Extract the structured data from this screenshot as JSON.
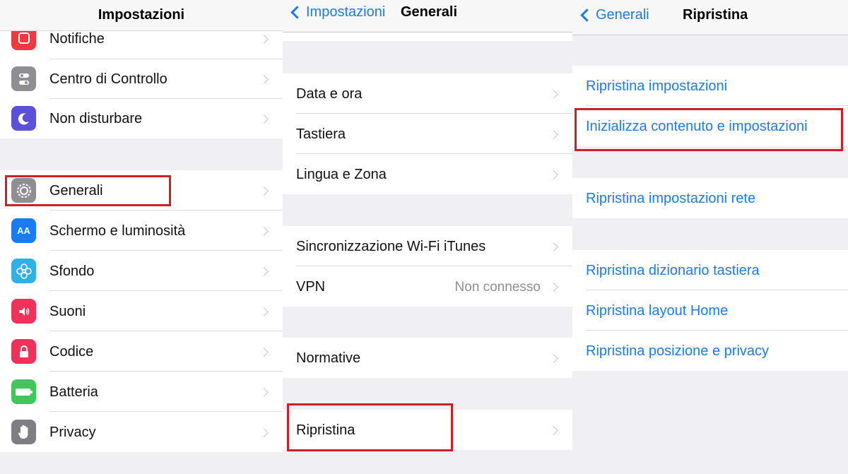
{
  "panel_settings": {
    "title": "Impostazioni",
    "items": [
      {
        "label": "Notifiche",
        "icon": "notifications-icon",
        "color": "#f0393c"
      },
      {
        "label": "Centro di Controllo",
        "icon": "control-center-icon",
        "color": "#8e8e93"
      },
      {
        "label": "Non disturbare",
        "icon": "moon-icon",
        "color": "#5b51d8"
      },
      {
        "label": "Generali",
        "icon": "gear-icon",
        "color": "#8e8e93"
      },
      {
        "label": "Schermo e luminosità",
        "icon": "display-brightness-icon",
        "icon_text": "AA",
        "color": "#1a7cf5"
      },
      {
        "label": "Sfondo",
        "icon": "wallpaper-flower-icon",
        "color": "#31b0e5"
      },
      {
        "label": "Suoni",
        "icon": "speaker-icon",
        "color": "#f0325a"
      },
      {
        "label": "Codice",
        "icon": "lock-icon",
        "color": "#f0325a"
      },
      {
        "label": "Batteria",
        "icon": "battery-icon",
        "color": "#3fc859"
      },
      {
        "label": "Privacy",
        "icon": "hand-icon",
        "color": "#7e7e84"
      }
    ]
  },
  "panel_general": {
    "back_label": "Impostazioni",
    "title": "Generali",
    "items": [
      {
        "label": "Data e ora"
      },
      {
        "label": "Tastiera"
      },
      {
        "label": "Lingua e Zona"
      },
      {
        "label": "Sincronizzazione Wi-Fi iTunes"
      },
      {
        "label": "VPN",
        "detail": "Non connesso"
      },
      {
        "label": "Normative"
      },
      {
        "label": "Ripristina"
      }
    ]
  },
  "panel_reset": {
    "back_label": "Generali",
    "title": "Ripristina",
    "items": [
      {
        "label": "Ripristina impostazioni"
      },
      {
        "label": "Inizializza contenuto e impostazioni"
      },
      {
        "label": "Ripristina impostazioni rete"
      },
      {
        "label": "Ripristina dizionario tastiera"
      },
      {
        "label": "Ripristina layout Home"
      },
      {
        "label": "Ripristina posizione e privacy"
      }
    ]
  },
  "accent_color": "#1a7cf5",
  "highlight_color": "#cc1f28"
}
